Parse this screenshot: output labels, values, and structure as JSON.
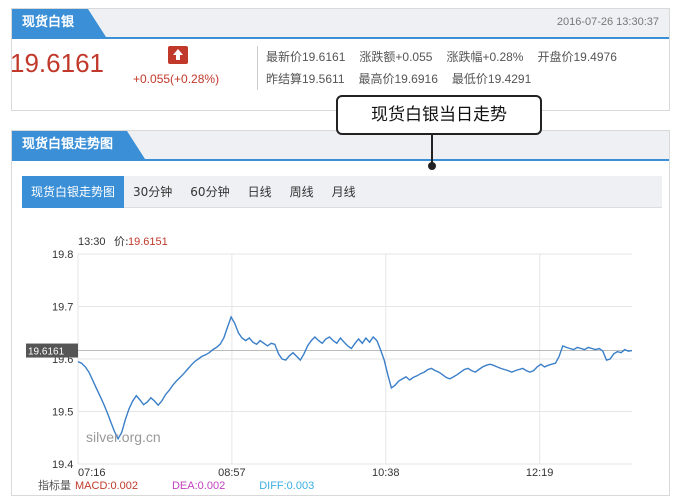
{
  "quote": {
    "title": "现货白银",
    "timestamp": "2016-07-26 13:30:37",
    "price": "19.6161",
    "change": "+0.055(+0.28%)",
    "stats": {
      "latest": "最新价19.6161",
      "change_amount": "涨跌额+0.055",
      "change_pct": "涨跌幅+0.28%",
      "open": "开盘价19.4976",
      "prev_settle": "昨结算19.5611",
      "high": "最高价19.6916",
      "low": "最低价19.4291"
    },
    "colors": {
      "up": "#c0392b",
      "accent": "#3a8fd6"
    }
  },
  "chart_panel": {
    "title": "现货白银走势图",
    "tabs": [
      {
        "label": "现货白银走势图",
        "active": true
      },
      {
        "label": "30分钟"
      },
      {
        "label": "60分钟"
      },
      {
        "label": "日线"
      },
      {
        "label": "周线"
      },
      {
        "label": "月线"
      }
    ],
    "hover_time": "13:30",
    "hover_price_label": "价:",
    "hover_price": "19.6151",
    "current_tag": "19.6161",
    "callout": "现货白银当日走势",
    "watermark": "silver.org.cn",
    "indicator_label": "指标量",
    "macd": "MACD:0.002",
    "dea": "DEA:0.002",
    "diff": "DIFF:0.003"
  },
  "chart_data": {
    "type": "line",
    "ylim": [
      19.4,
      19.8
    ],
    "yticks": [
      "19.8",
      "19.7",
      "19.6",
      "19.5",
      "19.4"
    ],
    "xticks": [
      "07:16",
      "08:57",
      "10:38",
      "12:19"
    ],
    "grid": true,
    "series": [
      {
        "values": [
          19.595,
          19.592,
          19.585,
          19.575,
          19.56,
          19.545,
          19.53,
          19.515,
          19.498,
          19.48,
          19.462,
          19.448,
          19.46,
          19.485,
          19.505,
          19.52,
          19.53,
          19.522,
          19.513,
          19.518,
          19.526,
          19.52,
          19.512,
          19.52,
          19.532,
          19.54,
          19.55,
          19.558,
          19.565,
          19.572,
          19.58,
          19.588,
          19.595,
          19.6,
          19.605,
          19.608,
          19.612,
          19.618,
          19.622,
          19.628,
          19.64,
          19.66,
          19.68,
          19.668,
          19.65,
          19.64,
          19.635,
          19.64,
          19.632,
          19.628,
          19.635,
          19.63,
          19.625,
          19.63,
          19.628,
          19.61,
          19.6,
          19.598,
          19.606,
          19.612,
          19.605,
          19.598,
          19.61,
          19.625,
          19.635,
          19.642,
          19.635,
          19.63,
          19.638,
          19.642,
          19.635,
          19.63,
          19.64,
          19.632,
          19.625,
          19.62,
          19.63,
          19.638,
          19.63,
          19.64,
          19.632,
          19.642,
          19.635,
          19.618,
          19.598,
          19.57,
          19.545,
          19.55,
          19.558,
          19.562,
          19.566,
          19.56,
          19.565,
          19.568,
          19.572,
          19.575,
          19.58,
          19.582,
          19.578,
          19.575,
          19.57,
          19.565,
          19.562,
          19.566,
          19.57,
          19.575,
          19.58,
          19.582,
          19.578,
          19.575,
          19.58,
          19.585,
          19.588,
          19.59,
          19.588,
          19.585,
          19.582,
          19.58,
          19.578,
          19.575,
          19.578,
          19.58,
          19.582,
          19.578,
          19.575,
          19.578,
          19.585,
          19.59,
          19.585,
          19.588,
          19.59,
          19.592,
          19.605,
          19.625,
          19.622,
          19.62,
          19.618,
          19.622,
          19.62,
          19.618,
          19.622,
          19.62,
          19.618,
          19.62,
          19.615,
          19.598,
          19.6,
          19.61,
          19.614,
          19.612,
          19.618,
          19.615,
          19.616
        ]
      }
    ]
  }
}
